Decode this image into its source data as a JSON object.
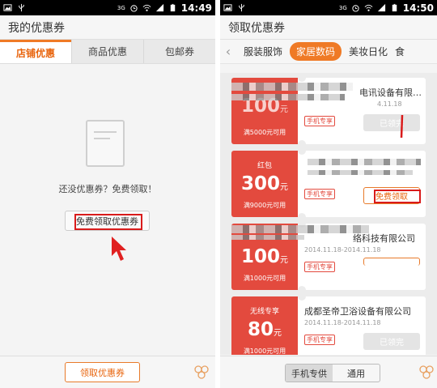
{
  "left": {
    "status": {
      "time": "14:49",
      "network": "3G"
    },
    "title": "我的优惠券",
    "tabs": [
      {
        "label": "店铺优惠",
        "active": true
      },
      {
        "label": "商品优惠",
        "active": false
      },
      {
        "label": "包邮券",
        "active": false
      }
    ],
    "empty_text": "还没优惠券？免费领取！",
    "free_get_label": "免费领取优惠券",
    "bottom_button": "领取优惠券"
  },
  "right": {
    "status": {
      "time": "14:50",
      "network": "3G"
    },
    "title": "领取优惠券",
    "categories": [
      {
        "label": "服装服饰",
        "active": false
      },
      {
        "label": "家居数码",
        "active": true
      },
      {
        "label": "美妆日化",
        "active": false
      },
      {
        "label": "食",
        "active": false
      }
    ],
    "coupons": [
      {
        "type": "",
        "amount": "100",
        "unit": "元",
        "condition": "满5000元可用",
        "name": "电讯设备有限…",
        "date": "4.11.18",
        "tag": "手机专享",
        "button": "已领完",
        "button_state": "done"
      },
      {
        "type": "红包",
        "amount": "300",
        "unit": "元",
        "condition": "满9000元可用",
        "name": "",
        "date": "",
        "tag": "手机专享",
        "button": "免费领取",
        "button_state": "free"
      },
      {
        "type": "",
        "amount": "100",
        "unit": "元",
        "condition": "满1000元可用",
        "name": "络科技有限公司",
        "date": "2014.11.18-2014.11.18",
        "tag": "手机专享",
        "button": "",
        "button_state": "free"
      },
      {
        "type": "无线专享",
        "amount": "80",
        "unit": "元",
        "condition": "满1000元可用",
        "name": "成都圣帝卫浴设备有限公司",
        "date": "2014.11.18-2014.11.18",
        "tag": "手机专享",
        "button": "已领完",
        "button_state": "done"
      }
    ],
    "bottom_tabs": [
      {
        "label": "手机专供",
        "active": true
      },
      {
        "label": "通用",
        "active": false
      }
    ]
  },
  "colors": {
    "accent": "#ef7a26",
    "coupon_red": "#e34a3e",
    "highlight": "#d91b1b"
  },
  "icons": [
    "image-icon",
    "usb-icon",
    "alarm-icon",
    "wifi-icon",
    "signal-icon",
    "battery-icon",
    "document-icon",
    "hexagon-menu-icon",
    "chevron-left-icon",
    "pointer-arrow-icon"
  ]
}
